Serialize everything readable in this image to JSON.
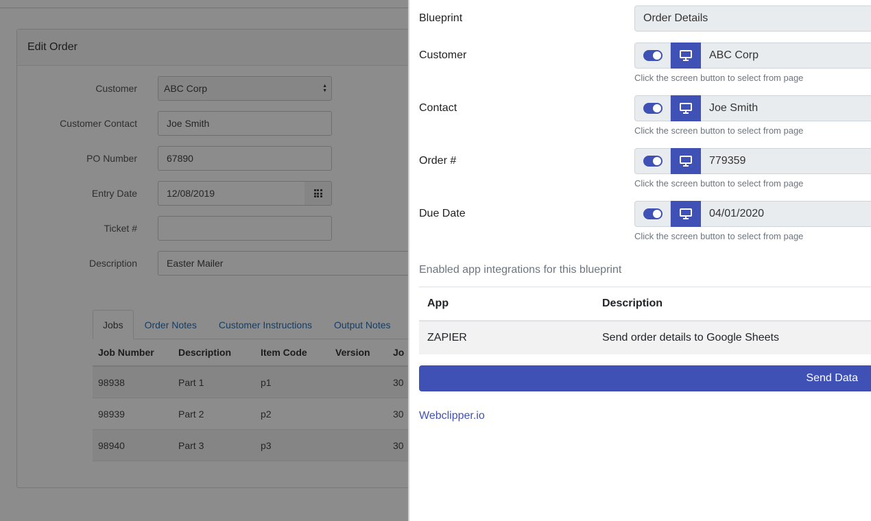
{
  "background": {
    "card_title": "Edit Order",
    "fields": [
      {
        "label": "Customer",
        "value": "ABC Corp",
        "type": "select"
      },
      {
        "label": "Customer Contact",
        "value": "Joe Smith",
        "type": "text"
      },
      {
        "label": "PO Number",
        "value": "67890",
        "type": "text"
      },
      {
        "label": "Entry Date",
        "value": "12/08/2019",
        "type": "date"
      },
      {
        "label": "Ticket #",
        "value": "",
        "type": "text"
      },
      {
        "label": "Description",
        "value": "Easter Mailer",
        "type": "text"
      }
    ],
    "tabs": [
      {
        "label": "Jobs",
        "active": true
      },
      {
        "label": "Order Notes"
      },
      {
        "label": "Customer Instructions"
      },
      {
        "label": "Output Notes"
      }
    ],
    "table": {
      "headers": [
        "Job Number",
        "Description",
        "Item Code",
        "Version",
        "Jo"
      ],
      "rows": [
        [
          "98938",
          "Part 1",
          "p1",
          "",
          "30"
        ],
        [
          "98939",
          "Part 2",
          "p2",
          "",
          "30"
        ],
        [
          "98940",
          "Part 3",
          "p3",
          "",
          "30"
        ]
      ]
    }
  },
  "panel": {
    "blueprint_label": "Blueprint",
    "blueprint_value": "Order Details",
    "help_text": "Click the screen button to select from page",
    "fields": [
      {
        "label": "Customer",
        "value": "ABC Corp",
        "enabled": true
      },
      {
        "label": "Contact",
        "value": "Joe Smith",
        "enabled": true
      },
      {
        "label": "Order #",
        "value": "779359",
        "enabled": true
      },
      {
        "label": "Due Date",
        "value": "04/01/2020",
        "enabled": true
      }
    ],
    "integrations_heading": "Enabled app integrations for this blueprint",
    "integrations_table": {
      "headers": [
        "App",
        "Description"
      ],
      "rows": [
        [
          "ZAPIER",
          "Send order details to Google Sheets"
        ]
      ]
    },
    "send_button": "Send Data",
    "footer_link": "Webclipper.io"
  },
  "colors": {
    "accent": "#3f51b5",
    "overlay": "rgba(0,0,0,0.45)"
  },
  "icons": {
    "screen_button": "monitor-icon",
    "date_picker": "calendar-grid-icon",
    "select": "select-arrows-icon"
  }
}
